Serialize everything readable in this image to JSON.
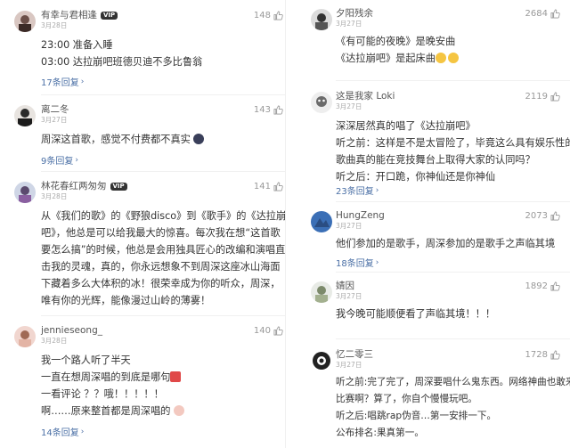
{
  "left": [
    {
      "user": "有幸与君相逢",
      "vip": "VIP",
      "date": "3月28日",
      "likes": "148",
      "lines": [
        "23:00 准备入睡",
        "03:00 达拉崩吧班德贝迪不多比鲁翁"
      ],
      "replies": "17条回复"
    },
    {
      "user": "离二冬",
      "vip": "",
      "date": "3月27日",
      "likes": "143",
      "lines": [
        "周深这首歌，感觉不付费都不真实"
      ],
      "replies": "9条回复"
    },
    {
      "user": "林花春红两匆匆",
      "vip": "VIP",
      "date": "3月28日",
      "likes": "141",
      "lines": [
        "从《我们的歌》的《野狼disco》到《歌手》的《达拉崩",
        "吧》，他总是可以给我最大的惊喜。每次我在想“这首歌",
        "要怎么搞”的时候，他总是会用独具匠心的改编和演唱直",
        "击我的灵魂，真的，你永远想象不到周深这座冰山海面",
        "下藏着多么大体积的冰！很荣幸成为你的听众，周深，",
        "唯有你的光辉，能像漫过山岭的薄雾！"
      ],
      "replies": ""
    },
    {
      "user": "jennieseong_",
      "vip": "",
      "date": "3月28日",
      "likes": "140",
      "lines": [
        "我一个路人听了半天",
        "一直在想周深唱的到底是哪句",
        "一看评论    ？？哦！！！！！",
        "啊……原来整首都是周深唱的"
      ],
      "replies": "14条回复"
    }
  ],
  "right": [
    {
      "user": "夕阳残余",
      "vip": "",
      "date": "3月27日",
      "likes": "2684",
      "lines": [
        "《有可能的夜晚》是晚安曲",
        "《达拉崩吧》是起床曲"
      ],
      "replies": ""
    },
    {
      "user": "这是我家 Loki",
      "vip": "",
      "date": "3月27日",
      "likes": "2119",
      "lines": [
        "深深居然真的唱了《达拉崩吧》",
        "听之前：这样是不是太冒险了，毕竟这么具有娱乐性的",
        "歌曲真的能在竞技舞台上取得大家的认同吗？",
        "听之后：开口跪，你神仙还是你神仙"
      ],
      "replies": "23条回复"
    },
    {
      "user": "HungZeng",
      "vip": "",
      "date": "3月27日",
      "likes": "2073",
      "lines": [
        "他们参加的是歌手，周深参加的是歌手之声临其境"
      ],
      "replies": "18条回复"
    },
    {
      "user": "婧因",
      "vip": "",
      "date": "3月27日",
      "likes": "1892",
      "lines": [
        "我今晚可能顺便看了声临其境！！！"
      ],
      "replies": ""
    },
    {
      "user": "忆二零三",
      "vip": "",
      "date": "3月27日",
      "likes": "1728",
      "lines": [
        "听之前:完了完了，周深要唱什么鬼东西。网络神曲也敢来",
        "比赛啊？算了，你自个慢慢玩吧。",
        "听之后:唱跳rap伪音…第一安排一下。",
        "公布排名:果真第一。"
      ],
      "replies": ""
    }
  ],
  "colors": {
    "link": "#4a6fa5",
    "text": "#333333",
    "meta": "#aaaaaa"
  },
  "icons": {
    "like": "thumbs-up-icon",
    "more": "chevron-right-icon"
  }
}
